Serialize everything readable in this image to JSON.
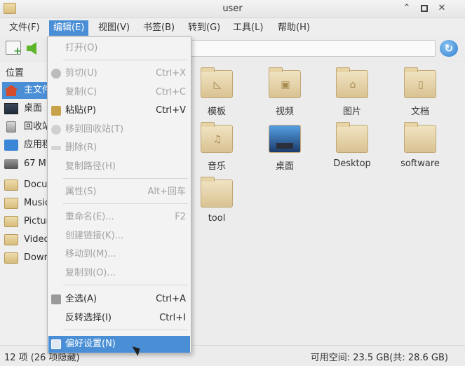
{
  "window": {
    "title": "user"
  },
  "menubar": {
    "items": [
      "文件(F)",
      "编辑(E)",
      "视图(V)",
      "书签(B)",
      "转到(G)",
      "工具(L)",
      "帮助(H)"
    ]
  },
  "sidebar": {
    "header": "位置",
    "items": [
      {
        "label": "主文件夹",
        "icon": "home-icon"
      },
      {
        "label": "桌面",
        "icon": "desktop-icon"
      },
      {
        "label": "回收站",
        "icon": "trash-icon"
      },
      {
        "label": "应用程序",
        "icon": "applications-icon"
      },
      {
        "label": "67 MB",
        "icon": "drive-icon"
      },
      {
        "label": "Documents",
        "icon": "folder-icon"
      },
      {
        "label": "Music",
        "icon": "folder-icon"
      },
      {
        "label": "Pictures",
        "icon": "folder-icon"
      },
      {
        "label": "Videos",
        "icon": "folder-icon"
      },
      {
        "label": "Downloads",
        "icon": "folder-icon"
      }
    ]
  },
  "files": [
    {
      "label": "模板",
      "icon": "templates-folder-icon",
      "emblem": "◺"
    },
    {
      "label": "视频",
      "icon": "videos-folder-icon",
      "emblem": "▣"
    },
    {
      "label": "图片",
      "icon": "pictures-folder-icon",
      "emblem": "⌂"
    },
    {
      "label": "文档",
      "icon": "documents-folder-icon",
      "emblem": "▯"
    },
    {
      "label": "音乐",
      "icon": "music-folder-icon",
      "emblem": "♫"
    },
    {
      "label": "桌面",
      "icon": "desktop-folder-icon",
      "emblem": ""
    },
    {
      "label": "Desktop",
      "icon": "folder-icon",
      "emblem": ""
    },
    {
      "label": "software",
      "icon": "folder-icon",
      "emblem": ""
    },
    {
      "label": "tool",
      "icon": "folder-icon",
      "emblem": ""
    }
  ],
  "edit_menu": {
    "open": {
      "label": "打开(O)",
      "shortcut": ""
    },
    "cut": {
      "label": "剪切(U)",
      "shortcut": "Ctrl+X"
    },
    "copy": {
      "label": "复制(C)",
      "shortcut": "Ctrl+C"
    },
    "paste": {
      "label": "粘贴(P)",
      "shortcut": "Ctrl+V"
    },
    "move_to_trash": {
      "label": "移到回收站(T)",
      "shortcut": ""
    },
    "delete": {
      "label": "删除(R)",
      "shortcut": ""
    },
    "copy_path": {
      "label": "复制路径(H)",
      "shortcut": ""
    },
    "properties": {
      "label": "属性(S)",
      "shortcut": "Alt+回车"
    },
    "rename": {
      "label": "重命名(E)...",
      "shortcut": "F2"
    },
    "create_link": {
      "label": "创建链接(K)...",
      "shortcut": ""
    },
    "move_to": {
      "label": "移动到(M)...",
      "shortcut": ""
    },
    "copy_to": {
      "label": "复制到(O)...",
      "shortcut": ""
    },
    "select_all": {
      "label": "全选(A)",
      "shortcut": "Ctrl+A"
    },
    "invert_selection": {
      "label": "反转选择(I)",
      "shortcut": "Ctrl+I"
    },
    "preferences": {
      "label": "偏好设置(N)",
      "shortcut": ""
    }
  },
  "statusbar": {
    "left": "12 项 (26 项隐藏)",
    "right": "可用空间: 23.5 GB(共: 28.6 GB)"
  },
  "colors": {
    "accent": "#4a8fd6",
    "disabled_text": "#a3a3a3"
  }
}
